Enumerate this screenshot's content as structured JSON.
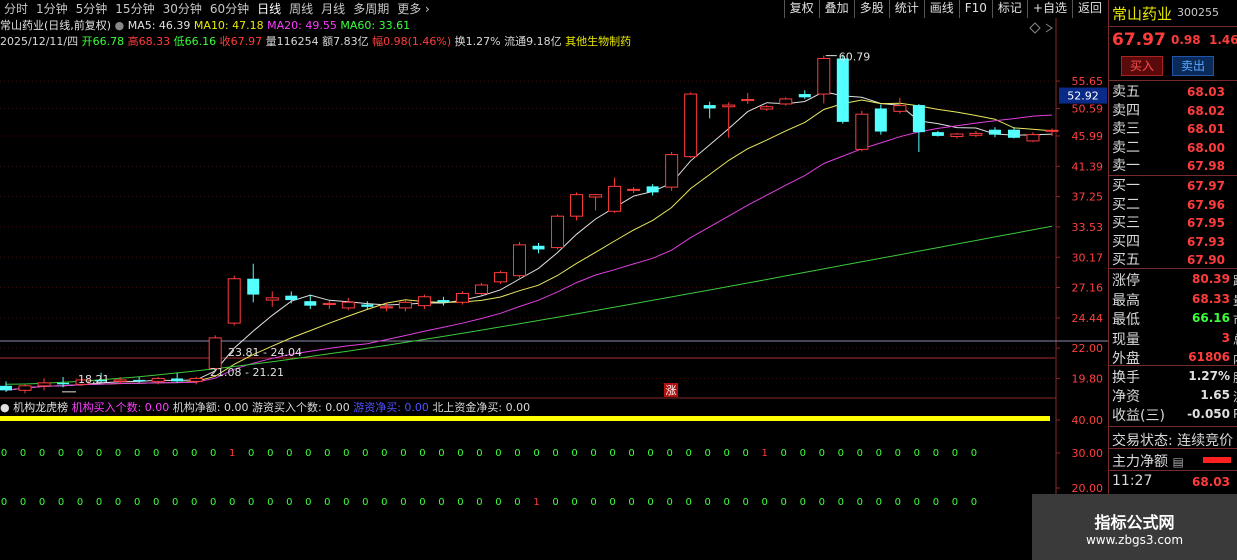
{
  "toolbar": {
    "tabs": [
      "分时",
      "1分钟",
      "5分钟",
      "15分钟",
      "30分钟",
      "60分钟",
      "日线",
      "周线",
      "月线",
      "多周期",
      "更多"
    ],
    "tools": [
      "复权",
      "叠加",
      "多股",
      "统计",
      "画线",
      "F10",
      "标记",
      "+自选",
      "返回"
    ]
  },
  "header": {
    "stock_name": "常山药业(日线,前复权)",
    "ma5": "MA5: 46.39",
    "ma10": "MA10: 47.18",
    "ma20": "MA20: 49.55",
    "ma60": "MA60: 33.61",
    "date": "2025/12/11/四",
    "open": "开66.78",
    "high": "高68.33",
    "low": "低66.16",
    "close": "收67.97",
    "volume": "量116254",
    "amount": "额7.83亿",
    "change": "幅0.98(1.46%)",
    "turnover": "换1.27%",
    "float": "流通9.18亿",
    "industry": "其他生物制药"
  },
  "price_axis": {
    "labels": [
      "55.65",
      "50.59",
      "45.99",
      "41.39",
      "37.25",
      "33.53",
      "30.17",
      "27.16",
      "24.44",
      "22.00",
      "19.80"
    ],
    "current_tag": "52.92"
  },
  "annotations": {
    "max": "60.79",
    "p1": "23.81",
    "p2": "24.04",
    "p3": "21.08",
    "p4": "21.21",
    "low": "18.21",
    "zhang": "涨"
  },
  "indicator": {
    "name": "机构龙虎榜",
    "items": [
      {
        "label": "机构买入个数: 0.00",
        "color": "#ff3cff"
      },
      {
        "label": "机构净额: 0.00",
        "color": "#d8d8d8"
      },
      {
        "label": "游资买入个数: 0.00",
        "color": "#d8d8d8"
      },
      {
        "label": "游资净买: 0.00",
        "color": "#5050ff"
      },
      {
        "label": "北上资金净买: 0.00",
        "color": "#d8d8d8"
      }
    ],
    "axis": [
      "40.00",
      "30.00",
      "20.00"
    ],
    "row1": "0000000000001000000000000000000000000000100000000000",
    "row2": "0000000000000000000000000000100000000000000000000000"
  },
  "quote": {
    "name": "常山药业",
    "code": "300255",
    "price": "67.97",
    "change": "0.98",
    "pct": "1.46%",
    "buy_button": "买入",
    "sell_button": "卖出",
    "asks": [
      {
        "label": "卖五",
        "price": "68.03"
      },
      {
        "label": "卖四",
        "price": "68.02"
      },
      {
        "label": "卖三",
        "price": "68.01"
      },
      {
        "label": "卖二",
        "price": "68.00"
      },
      {
        "label": "卖一",
        "price": "67.98"
      }
    ],
    "bids": [
      {
        "label": "买一",
        "price": "67.97"
      },
      {
        "label": "买二",
        "price": "67.96"
      },
      {
        "label": "买三",
        "price": "67.95"
      },
      {
        "label": "买四",
        "price": "67.93"
      },
      {
        "label": "买五",
        "price": "67.90"
      }
    ],
    "stats": [
      {
        "label": "涨停",
        "value": "80.39",
        "color": "#ff3c3c",
        "tail": "跌"
      },
      {
        "label": "最高",
        "value": "68.33",
        "color": "#ff3c3c",
        "tail": "量"
      },
      {
        "label": "最低",
        "value": "66.16",
        "color": "#3cff3c",
        "tail": "市"
      },
      {
        "label": "现量",
        "value": "3",
        "color": "#ff3c3c",
        "tail": "总"
      },
      {
        "label": "外盘",
        "value": "61806",
        "color": "#ff3c3c",
        "tail": "内"
      }
    ],
    "stats2": [
      {
        "label": "换手",
        "value": "1.27%",
        "tail": "股"
      },
      {
        "label": "净资",
        "value": "1.65",
        "tail": "流"
      },
      {
        "label": "收益(三)",
        "value": "-0.050",
        "tail": "P"
      }
    ],
    "trade_status": "交易状态: 连续竞价",
    "main_net": "主力净额",
    "tick_time": "11:27",
    "tick_price": "68.03"
  },
  "watermark": {
    "line1": "指标公式网",
    "line2": "www.zbgs3.com"
  },
  "chart_data": {
    "type": "candlestick",
    "ylim": [
      18.5,
      62
    ],
    "candles": [
      {
        "o": 19.3,
        "h": 19.6,
        "l": 18.9,
        "c": 19.0
      },
      {
        "o": 19.0,
        "h": 19.4,
        "l": 18.8,
        "c": 19.3
      },
      {
        "o": 19.3,
        "h": 19.8,
        "l": 19.0,
        "c": 19.5
      },
      {
        "o": 19.5,
        "h": 19.9,
        "l": 19.2,
        "c": 19.4
      },
      {
        "o": 19.4,
        "h": 19.8,
        "l": 19.3,
        "c": 19.7
      },
      {
        "o": 19.7,
        "h": 20.2,
        "l": 19.5,
        "c": 19.6
      },
      {
        "o": 19.6,
        "h": 19.9,
        "l": 19.4,
        "c": 19.7
      },
      {
        "o": 19.7,
        "h": 19.9,
        "l": 19.5,
        "c": 19.6
      },
      {
        "o": 19.6,
        "h": 19.9,
        "l": 19.4,
        "c": 19.8
      },
      {
        "o": 19.8,
        "h": 20.2,
        "l": 19.5,
        "c": 19.6
      },
      {
        "o": 19.6,
        "h": 19.9,
        "l": 19.4,
        "c": 19.8
      },
      {
        "o": 20.5,
        "h": 23.0,
        "l": 20.3,
        "c": 22.8
      },
      {
        "o": 24.0,
        "h": 28.3,
        "l": 23.8,
        "c": 28.0
      },
      {
        "o": 28.0,
        "h": 29.5,
        "l": 25.8,
        "c": 26.5
      },
      {
        "o": 26.0,
        "h": 26.8,
        "l": 25.4,
        "c": 26.2
      },
      {
        "o": 26.4,
        "h": 26.8,
        "l": 25.7,
        "c": 26.0
      },
      {
        "o": 25.9,
        "h": 26.5,
        "l": 25.2,
        "c": 25.5
      },
      {
        "o": 25.6,
        "h": 25.9,
        "l": 25.2,
        "c": 25.7
      },
      {
        "o": 25.3,
        "h": 26.2,
        "l": 25.1,
        "c": 25.8
      },
      {
        "o": 25.6,
        "h": 25.9,
        "l": 25.2,
        "c": 25.4
      },
      {
        "o": 25.3,
        "h": 25.7,
        "l": 25.0,
        "c": 25.4
      },
      {
        "o": 25.3,
        "h": 26.0,
        "l": 25.0,
        "c": 25.8
      },
      {
        "o": 25.5,
        "h": 26.5,
        "l": 25.2,
        "c": 26.3
      },
      {
        "o": 26.0,
        "h": 26.3,
        "l": 25.5,
        "c": 25.8
      },
      {
        "o": 25.8,
        "h": 26.8,
        "l": 25.6,
        "c": 26.6
      },
      {
        "o": 26.6,
        "h": 27.6,
        "l": 26.4,
        "c": 27.4
      },
      {
        "o": 27.7,
        "h": 28.8,
        "l": 27.5,
        "c": 28.6
      },
      {
        "o": 28.3,
        "h": 31.8,
        "l": 28.1,
        "c": 31.5
      },
      {
        "o": 31.4,
        "h": 31.7,
        "l": 30.6,
        "c": 31.0
      },
      {
        "o": 31.2,
        "h": 35.0,
        "l": 31.0,
        "c": 34.8
      },
      {
        "o": 34.8,
        "h": 37.8,
        "l": 34.3,
        "c": 37.5
      },
      {
        "o": 37.2,
        "h": 37.6,
        "l": 35.5,
        "c": 37.5
      },
      {
        "o": 35.4,
        "h": 39.8,
        "l": 35.2,
        "c": 38.6
      },
      {
        "o": 38.2,
        "h": 38.5,
        "l": 37.7,
        "c": 38.2
      },
      {
        "o": 38.6,
        "h": 38.9,
        "l": 37.4,
        "c": 37.8
      },
      {
        "o": 38.5,
        "h": 43.5,
        "l": 38.0,
        "c": 43.1
      },
      {
        "o": 42.8,
        "h": 53.5,
        "l": 42.6,
        "c": 53.2
      },
      {
        "o": 51.2,
        "h": 51.8,
        "l": 48.9,
        "c": 50.6
      },
      {
        "o": 50.9,
        "h": 51.7,
        "l": 45.7,
        "c": 51.2
      },
      {
        "o": 52.0,
        "h": 53.4,
        "l": 51.4,
        "c": 52.2
      },
      {
        "o": 50.5,
        "h": 51.2,
        "l": 50.2,
        "c": 50.9
      },
      {
        "o": 51.4,
        "h": 52.6,
        "l": 51.1,
        "c": 52.3
      },
      {
        "o": 53.2,
        "h": 53.9,
        "l": 52.3,
        "c": 52.6
      },
      {
        "o": 53.2,
        "h": 60.8,
        "l": 51.5,
        "c": 60.2
      },
      {
        "o": 60.2,
        "h": 61.0,
        "l": 48.0,
        "c": 48.3
      },
      {
        "o": 43.9,
        "h": 50.2,
        "l": 43.6,
        "c": 49.6
      },
      {
        "o": 50.6,
        "h": 51.3,
        "l": 46.2,
        "c": 46.7
      },
      {
        "o": 50.1,
        "h": 52.5,
        "l": 49.7,
        "c": 51.1
      },
      {
        "o": 51.2,
        "h": 51.4,
        "l": 43.5,
        "c": 46.6
      },
      {
        "o": 46.6,
        "h": 46.8,
        "l": 45.9,
        "c": 46.0
      },
      {
        "o": 45.9,
        "h": 46.5,
        "l": 45.6,
        "c": 46.3
      },
      {
        "o": 46.1,
        "h": 46.8,
        "l": 45.8,
        "c": 46.4
      },
      {
        "o": 47.0,
        "h": 47.4,
        "l": 45.8,
        "c": 46.2
      },
      {
        "o": 47.0,
        "h": 47.4,
        "l": 45.6,
        "c": 45.7
      },
      {
        "o": 45.2,
        "h": 46.6,
        "l": 45.0,
        "c": 46.2
      },
      {
        "o": 46.8,
        "h": 47.2,
        "l": 46.0,
        "c": 46.9
      }
    ]
  }
}
